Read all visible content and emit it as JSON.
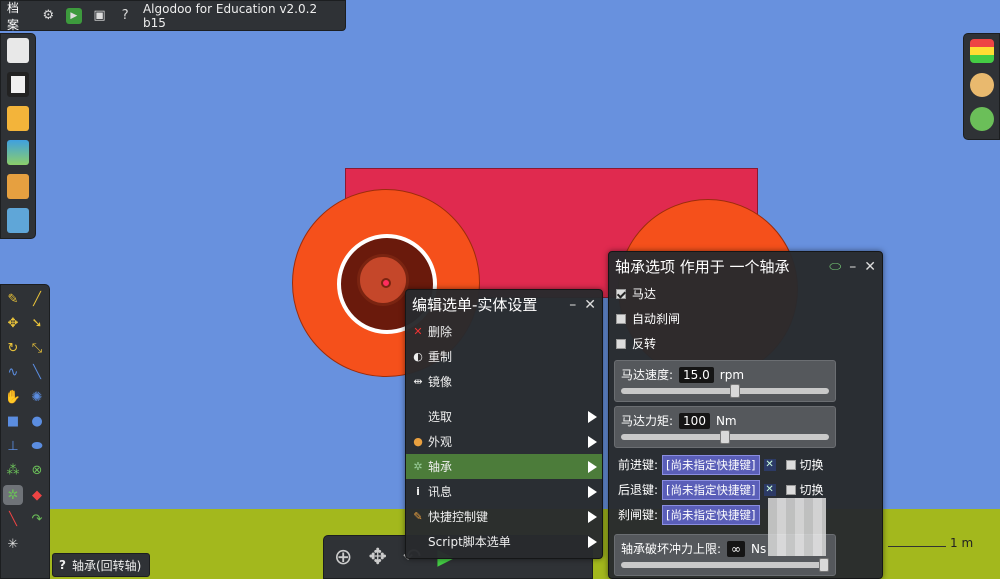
{
  "topbar": {
    "file_label": "档案",
    "title": "Algodoo for Education v2.0.2 b15",
    "help": "?"
  },
  "tooltip": {
    "label": "轴承(回转轴)",
    "key": "?"
  },
  "scale": {
    "label": "1 m"
  },
  "menu": {
    "title": "编辑选单-实体设置",
    "items": [
      {
        "label": "删除",
        "icon": "✕"
      },
      {
        "label": "重制",
        "icon": "◐"
      },
      {
        "label": "镜像",
        "icon": "⇹"
      },
      {
        "label": "选取",
        "icon": ""
      },
      {
        "label": "外观",
        "icon": "●"
      },
      {
        "label": "轴承",
        "icon": "✲"
      },
      {
        "label": "讯息",
        "icon": "i"
      },
      {
        "label": "快捷控制键",
        "icon": "✎"
      },
      {
        "label": "Script脚本选单",
        "icon": ""
      }
    ]
  },
  "axle": {
    "title": "轴承选项 作用于 一个轴承",
    "motor": "马达",
    "auto_brake": "自动刹闸",
    "reverse": "反转",
    "speed_label": "马达速度:",
    "speed_value": "15.0",
    "speed_unit": "rpm",
    "speed_slider": 0.55,
    "torque_label": "马达力矩:",
    "torque_value": "100",
    "torque_unit": "Nm",
    "torque_slider": 0.5,
    "forward_label": "前进键:",
    "backward_label": "后退键:",
    "brake_label": "刹闸键:",
    "unassigned": "[尚未指定快捷键]",
    "toggle_label": "切换",
    "break_label": "轴承破坏冲力上限:",
    "break_value": "∞",
    "break_unit": "Ns",
    "break_slider": 1.0
  },
  "colors": {
    "sky": "#6891de",
    "ground": "#a3b81d",
    "body": "#e02a4f",
    "wheel": "#f5501b",
    "active": "#4c7c3a"
  }
}
